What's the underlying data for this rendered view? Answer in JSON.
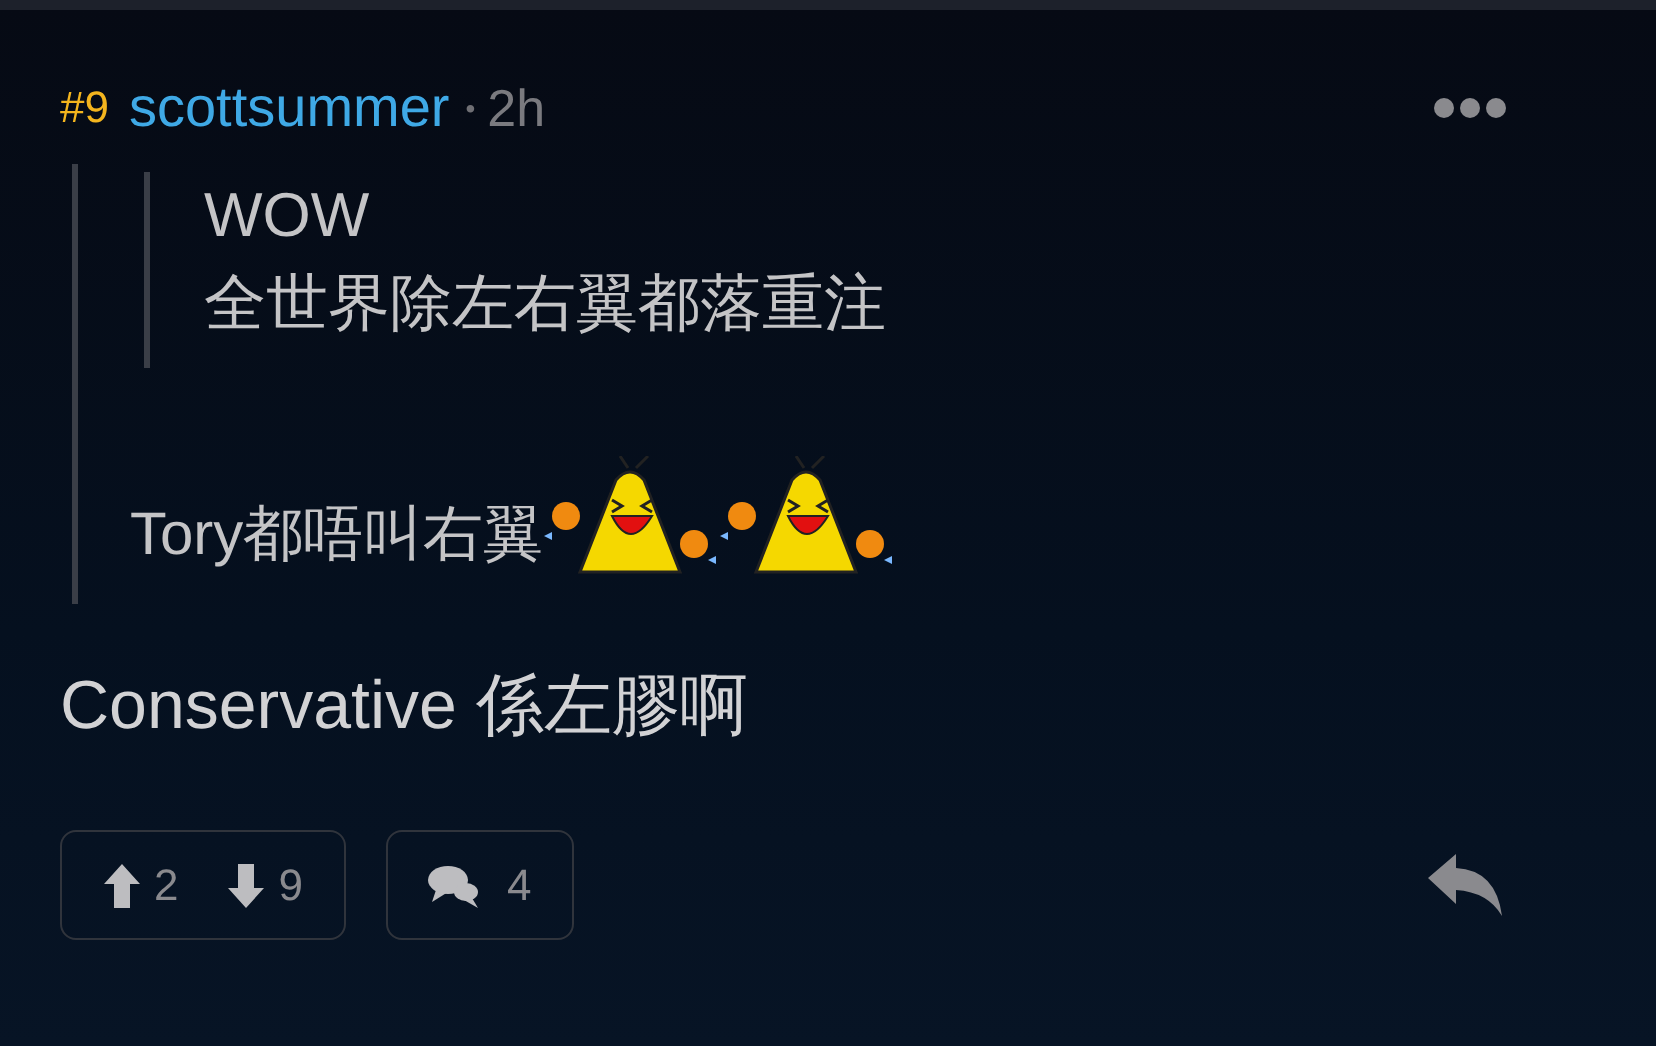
{
  "post": {
    "number": "#9",
    "author": "scottsummer",
    "separator": "•",
    "time": "2h"
  },
  "quote": {
    "inner": {
      "lines": [
        "WOW",
        "全世界除左右翼都落重注"
      ]
    },
    "text": "Tory都唔叫右翼",
    "stickers": [
      {
        "kind": "laughing"
      },
      {
        "kind": "laughing"
      }
    ]
  },
  "body": "Conservative 係左膠啊",
  "actions": {
    "upvotes": "2",
    "downvotes": "9",
    "comments": "4"
  }
}
